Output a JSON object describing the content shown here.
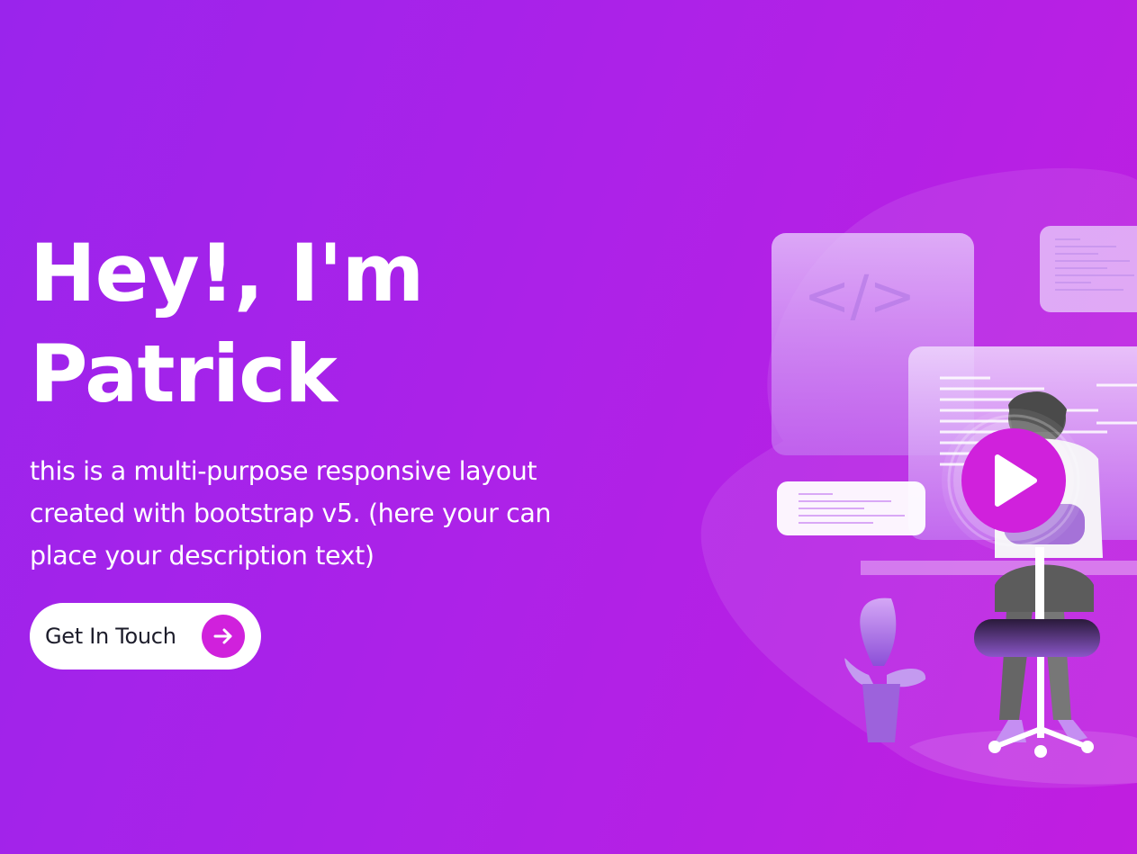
{
  "hero": {
    "title_line1": "Hey!, I'm",
    "title_line2": "Patrick",
    "description": "this is a multi-purpose responsive layout created with bootstrap v5. (here your can place your description text)",
    "cta_label": "Get In Touch"
  },
  "illustration": {
    "code_tag": "</>"
  },
  "colors": {
    "background_start": "#9a24ec",
    "background_end": "#c11ee0",
    "accent": "#d021dc",
    "button_bg": "#ffffff",
    "button_text": "#1d1d2b"
  },
  "icons": [
    "arrow-right-icon",
    "play-icon",
    "code-tag-icon"
  ]
}
